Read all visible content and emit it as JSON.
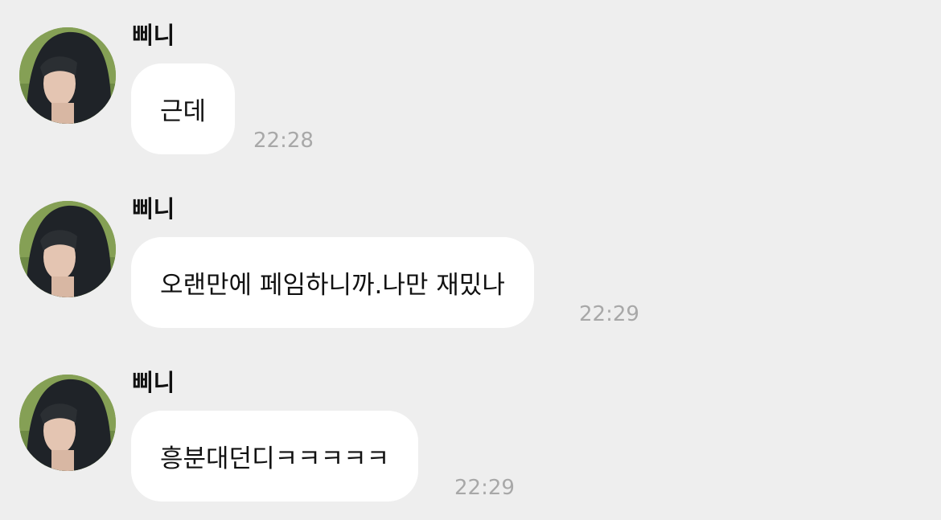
{
  "chat": {
    "messages": [
      {
        "sender": "삐니",
        "text": "근데",
        "time": "22:28"
      },
      {
        "sender": "삐니",
        "text": "오랜만에 페임하니까.나만 재밌나",
        "time": "22:29"
      },
      {
        "sender": "삐니",
        "text": "흥분대던디ㅋㅋㅋㅋㅋ",
        "time": "22:29"
      }
    ]
  },
  "colors": {
    "background": "#eeeeee",
    "bubble": "#ffffff",
    "timestamp": "#a8a8a8"
  }
}
